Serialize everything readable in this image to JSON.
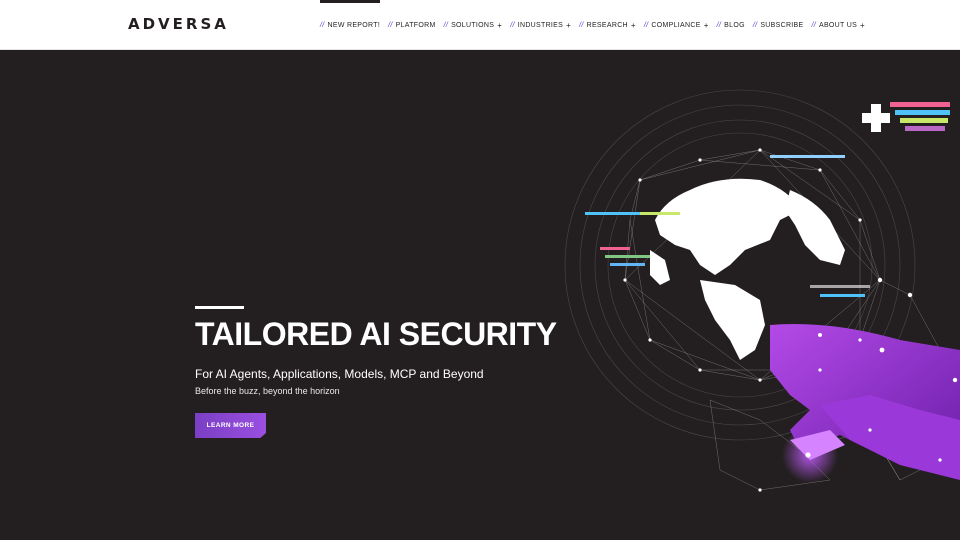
{
  "brand": {
    "logo_text": "ADVERSA"
  },
  "nav": {
    "items": [
      {
        "label": "NEW REPORT!",
        "has_submenu": false
      },
      {
        "label": "PLATFORM",
        "has_submenu": false
      },
      {
        "label": "SOLUTIONS",
        "has_submenu": true
      },
      {
        "label": "INDUSTRIES",
        "has_submenu": true
      },
      {
        "label": "RESEARCH",
        "has_submenu": true
      },
      {
        "label": "COMPLIANCE",
        "has_submenu": true
      },
      {
        "label": "BLOG",
        "has_submenu": false
      },
      {
        "label": "SUBSCRIBE",
        "has_submenu": false
      },
      {
        "label": "ABOUT US",
        "has_submenu": true
      }
    ],
    "separator": "//",
    "submenu_marker": "+"
  },
  "hero": {
    "title": "TAILORED AI SECURITY",
    "subtitle": "For AI Agents, Applications, Models, MCP and Beyond",
    "tagline": "Before the buzz, beyond the horizon",
    "cta_label": "LEARN MORE"
  },
  "colors": {
    "background": "#231f20",
    "accent": "#8a45d6",
    "nav_slash": "#5a3fd1"
  },
  "icons": [
    "globe-network-illustration",
    "robotic-hand-illustration"
  ]
}
